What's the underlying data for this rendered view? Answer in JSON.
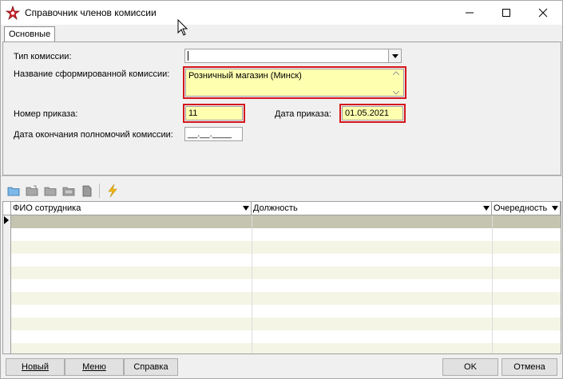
{
  "window": {
    "title": "Справочник членов комиссии",
    "minimize": "—",
    "maximize": "☐",
    "close": "✕"
  },
  "tabs": [
    {
      "label": "Основные"
    }
  ],
  "form": {
    "commission_type_label": "Тип комиссии:",
    "commission_type_value": "",
    "commission_name_label": "Название сформированной комиссии:",
    "commission_name_value": "Розничный магазин (Минск)",
    "order_number_label": "Номер приказа:",
    "order_number_value": "11",
    "order_date_label": "Дата приказа:",
    "order_date_value": "01.05.2021",
    "end_date_label": "Дата окончания полномочий комиссии:",
    "end_date_value": "__.__.____"
  },
  "toolbar": {
    "icons": [
      "folder-new-icon",
      "folder-open-icon",
      "folder-edit-icon",
      "folder-delete-icon",
      "document-icon",
      "lightning-icon"
    ]
  },
  "grid": {
    "columns": [
      {
        "label": "ФИО сотрудника"
      },
      {
        "label": "Должность"
      },
      {
        "label": "Очередность"
      }
    ]
  },
  "buttons": {
    "new_label": "Новый",
    "menu_label": "Меню",
    "help_label": "Справка",
    "ok_label": "OK",
    "cancel_label": "Отмена"
  },
  "colors": {
    "highlight_border": "#d4161c",
    "field_yellow": "#ffffb0",
    "selected_row": "#c4c4b0"
  }
}
